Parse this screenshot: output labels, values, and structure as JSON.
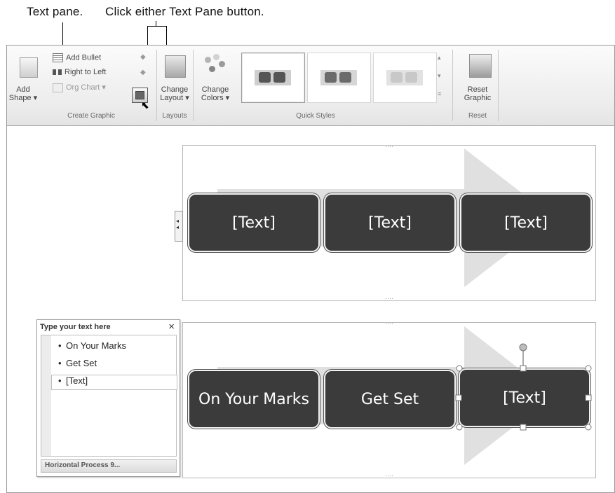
{
  "callouts": {
    "text_pane": "Text pane.",
    "click_button": "Click either Text Pane button."
  },
  "ribbon": {
    "create_graphic": {
      "add_shape": "Add Shape",
      "add_bullet": "Add Bullet",
      "right_to_left": "Right to Left",
      "org_chart": "Org Chart",
      "group_label": "Create Graphic"
    },
    "layouts": {
      "change_layout": "Change Layout",
      "group_label": "Layouts"
    },
    "quick_styles": {
      "change_colors": "Change Colors",
      "group_label": "Quick Styles"
    },
    "reset": {
      "reset_graphic": "Reset Graphic",
      "group_label": "Reset"
    }
  },
  "diagram_top": {
    "boxes": [
      "[Text]",
      "[Text]",
      "[Text]"
    ]
  },
  "diagram_bottom": {
    "boxes": [
      "On Your Marks",
      "Get Set",
      "[Text]"
    ]
  },
  "text_pane": {
    "title": "Type your text here",
    "close": "×",
    "items": [
      "On Your Marks",
      "Get Set",
      "[Text]"
    ],
    "footer": "Horizontal Process 9..."
  },
  "colors": {
    "shape_fill": "#3b3b3b",
    "arrow_fill": "#e0e0e0"
  }
}
